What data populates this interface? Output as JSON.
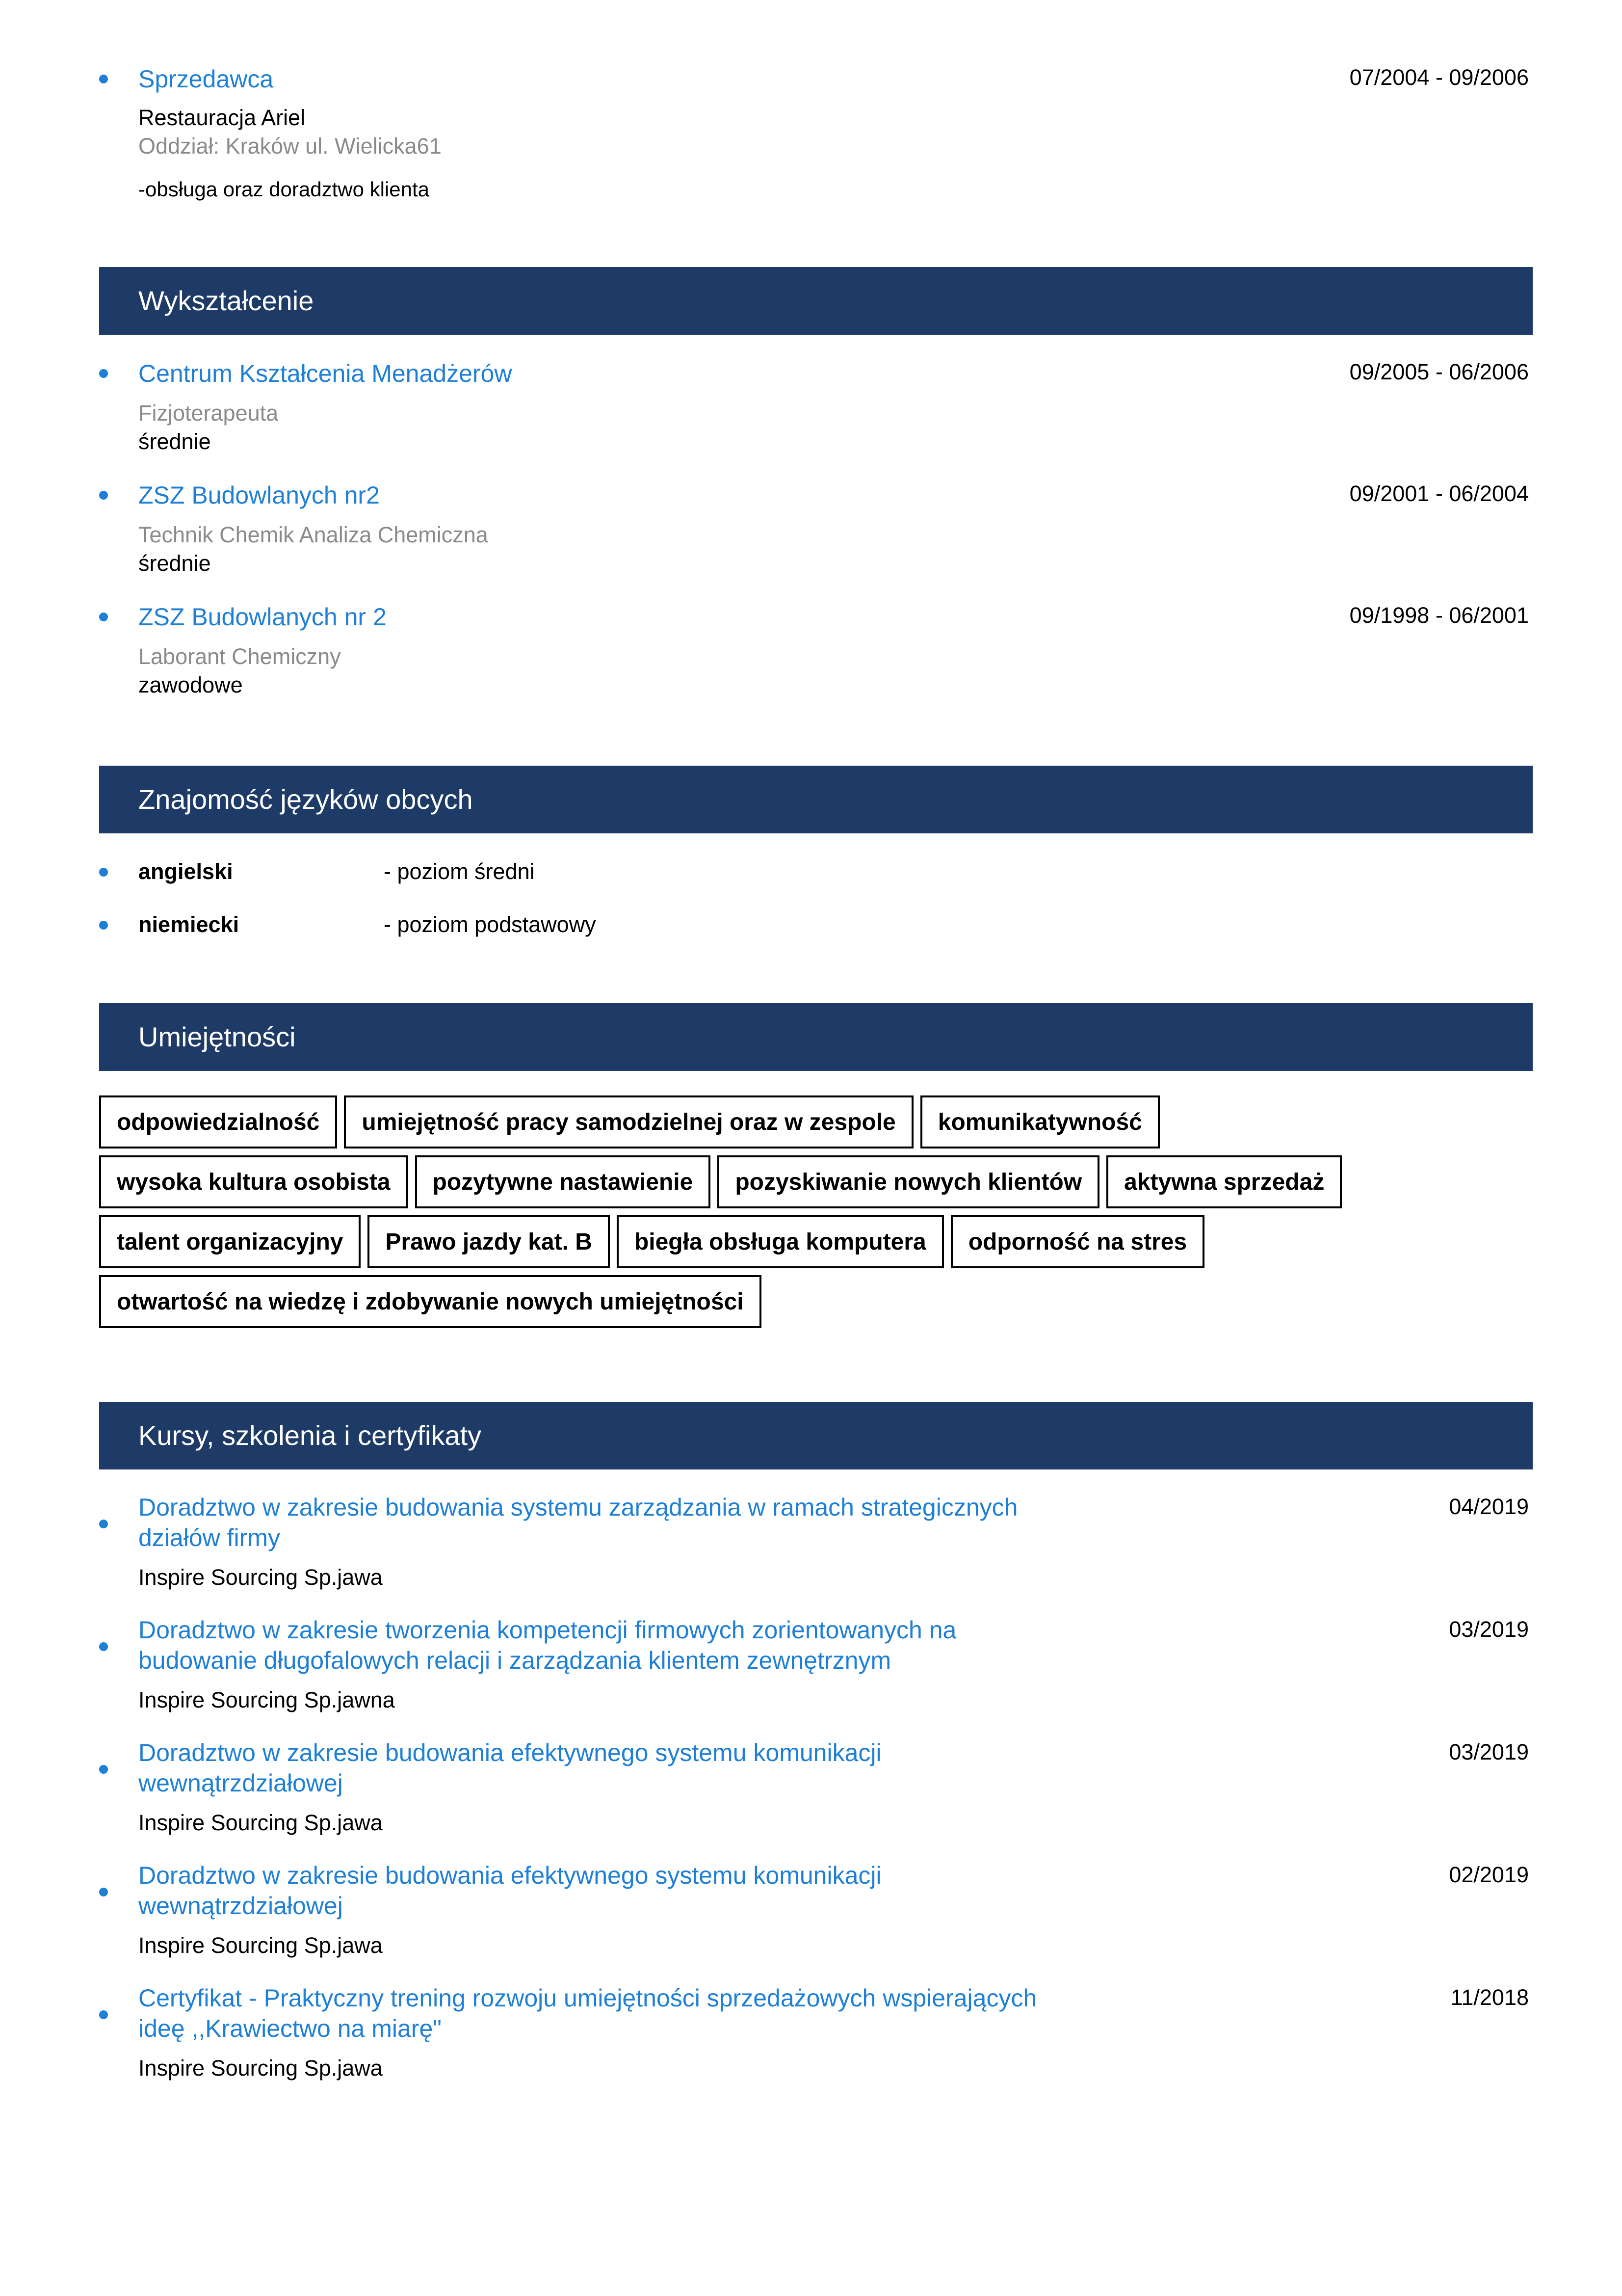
{
  "experience_tail": {
    "title": "Sprzedawca",
    "employer": "Restauracja Ariel",
    "branch": "Oddział: Kraków ul. Wielicka61",
    "description": "-obsługa oraz doradztwo klienta",
    "dates": "07/2004 - 09/2006"
  },
  "education": {
    "header": "Wykształcenie",
    "items": [
      {
        "school": "Centrum Kształcenia Menadżerów",
        "field": "Fizjoterapeuta",
        "level": "średnie",
        "dates": "09/2005 - 06/2006"
      },
      {
        "school": "ZSZ Budowlanych nr2",
        "field": "Technik Chemik Analiza Chemiczna",
        "level": "średnie",
        "dates": "09/2001 - 06/2004"
      },
      {
        "school": "ZSZ Budowlanych nr 2",
        "field": "Laborant Chemiczny",
        "level": "zawodowe",
        "dates": "09/1998 - 06/2001"
      }
    ]
  },
  "languages": {
    "header": "Znajomość języków obcych",
    "items": [
      {
        "name": "angielski",
        "level": "- poziom średni"
      },
      {
        "name": "niemiecki",
        "level": "- poziom podstawowy"
      }
    ]
  },
  "skills": {
    "header": "Umiejętności",
    "rows": [
      [
        "odpowiedzialność",
        "umiejętność pracy samodzielnej oraz w zespole",
        "komunikatywność"
      ],
      [
        "wysoka kultura osobista",
        "pozytywne nastawienie",
        "pozyskiwanie nowych klientów",
        "aktywna sprzedaż"
      ],
      [
        "talent organizacyjny",
        "Prawo jazdy kat. B",
        "biegła obsługa komputera",
        "odporność na stres"
      ],
      [
        "otwartość na wiedzę i zdobywanie nowych umiejętności"
      ]
    ]
  },
  "courses": {
    "header": "Kursy, szkolenia i certyfikaty",
    "items": [
      {
        "title": "Doradztwo w zakresie budowania systemu zarządzania w ramach strategicznych działów firmy",
        "org": "Inspire Sourcing Sp.jawa",
        "date": "04/2019"
      },
      {
        "title": "Doradztwo w zakresie tworzenia kompetencji firmowych zorientowanych na budowanie długofalowych relacji i zarządzania klientem zewnętrznym",
        "org": "Inspire Sourcing Sp.jawna",
        "date": "03/2019"
      },
      {
        "title": "Doradztwo w zakresie budowania efektywnego systemu komunikacji wewnątrzdziałowej",
        "org": "Inspire Sourcing Sp.jawa",
        "date": "03/2019"
      },
      {
        "title": "Doradztwo w zakresie budowania efektywnego systemu komunikacji wewnątrzdziałowej",
        "org": "Inspire Sourcing Sp.jawa",
        "date": "02/2019"
      },
      {
        "title": "Certyfikat - Praktyczny trening rozwoju umiejętności sprzedażowych wspierających ideę ,,Krawiectwo na miarę\"",
        "org": "Inspire Sourcing Sp.jawa",
        "date": "11/2018"
      }
    ]
  },
  "colors": {
    "accent": "#1e7fd6",
    "header_bg": "#1e3a66",
    "muted": "#8a8a8a"
  }
}
